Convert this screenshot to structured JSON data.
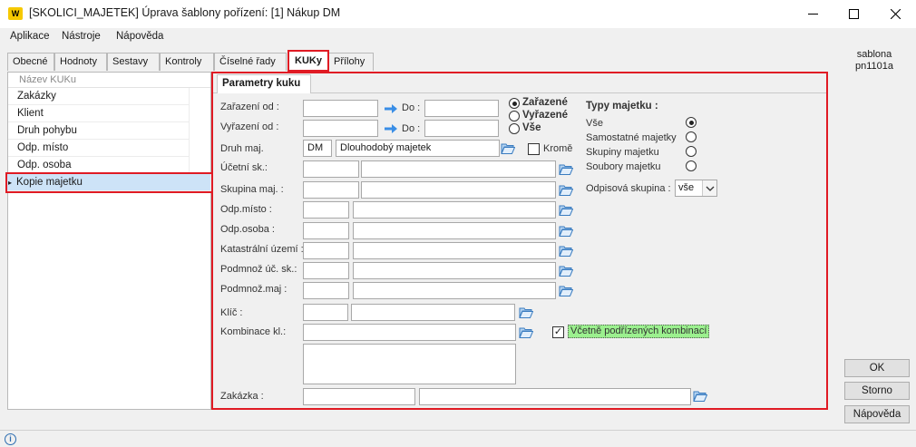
{
  "window": {
    "title": "[SKOLICI_MAJETEK] Úprava šablony pořízení: [1] Nákup DM",
    "logo_text": "W",
    "minimize_icon": "minimize-icon",
    "maximize_icon": "maximize-icon",
    "close_icon": "close-icon"
  },
  "menu": [
    "Aplikace",
    "Nástroje",
    "Nápověda"
  ],
  "tabs": [
    "Obecné",
    "Hodnoty",
    "Sestavy",
    "Kontroly",
    "Číselné řady",
    "KUKy",
    "Přílohy"
  ],
  "active_tab": "KUKy",
  "left_list": {
    "header": "Název KUKu",
    "items": [
      "Zakázky",
      "Klient",
      "Druh pohybu",
      "Odp. místo",
      "Odp. osoba",
      "Kopie majetku"
    ],
    "selected": "Kopie majetku",
    "row_marker": "▸"
  },
  "panel": {
    "subtab": "Parametry kuku",
    "zarazeni_od_label": "Zařazení od :",
    "vyrazeni_od_label": "Vyřazení od :",
    "do_label": "Do :",
    "date_mode_options": [
      "Zařazené",
      "Vyřazené",
      "Vše"
    ],
    "date_mode_selected": "Zařazené",
    "druh_maj_label": "Druh maj.",
    "druh_maj_code": "DM",
    "druh_maj_name": "Dlouhodobý majetek",
    "krome_label": "Kromě",
    "krome_checked": false,
    "fields": [
      {
        "label": "Účetní sk.:"
      },
      {
        "label": "Skupina maj. :"
      },
      {
        "label": "Odp.místo :"
      },
      {
        "label": "Odp.osoba :"
      },
      {
        "label": "Katastrální území :"
      },
      {
        "label": "Podmnož úč. sk.:"
      },
      {
        "label": "Podmnož.maj :"
      }
    ],
    "klic_label": "Klíč :",
    "kombinace_label": "Kombinace kl.:",
    "vcetne_label": "Včetně podřízených kombinací",
    "vcetne_checked": true,
    "zakazka_label": "Zakázka :",
    "typy_title": "Typy majetku :",
    "typy_options": [
      "Vše",
      "Samostatné majetky",
      "Skupiny majetku",
      "Soubory majetku"
    ],
    "typy_selected": "Vše",
    "odpisova_label": "Odpisová skupina :",
    "odpisova_value": "vše",
    "arrow_icon": "arrow-right-icon",
    "folder_icon": "folder-open-icon"
  },
  "side": {
    "template_name": "sablona",
    "template_id": "pn1101a",
    "ok": "OK",
    "storno": "Storno",
    "napoveda": "Nápověda"
  },
  "status": {
    "info_icon": "info-icon",
    "info_glyph": "i"
  }
}
